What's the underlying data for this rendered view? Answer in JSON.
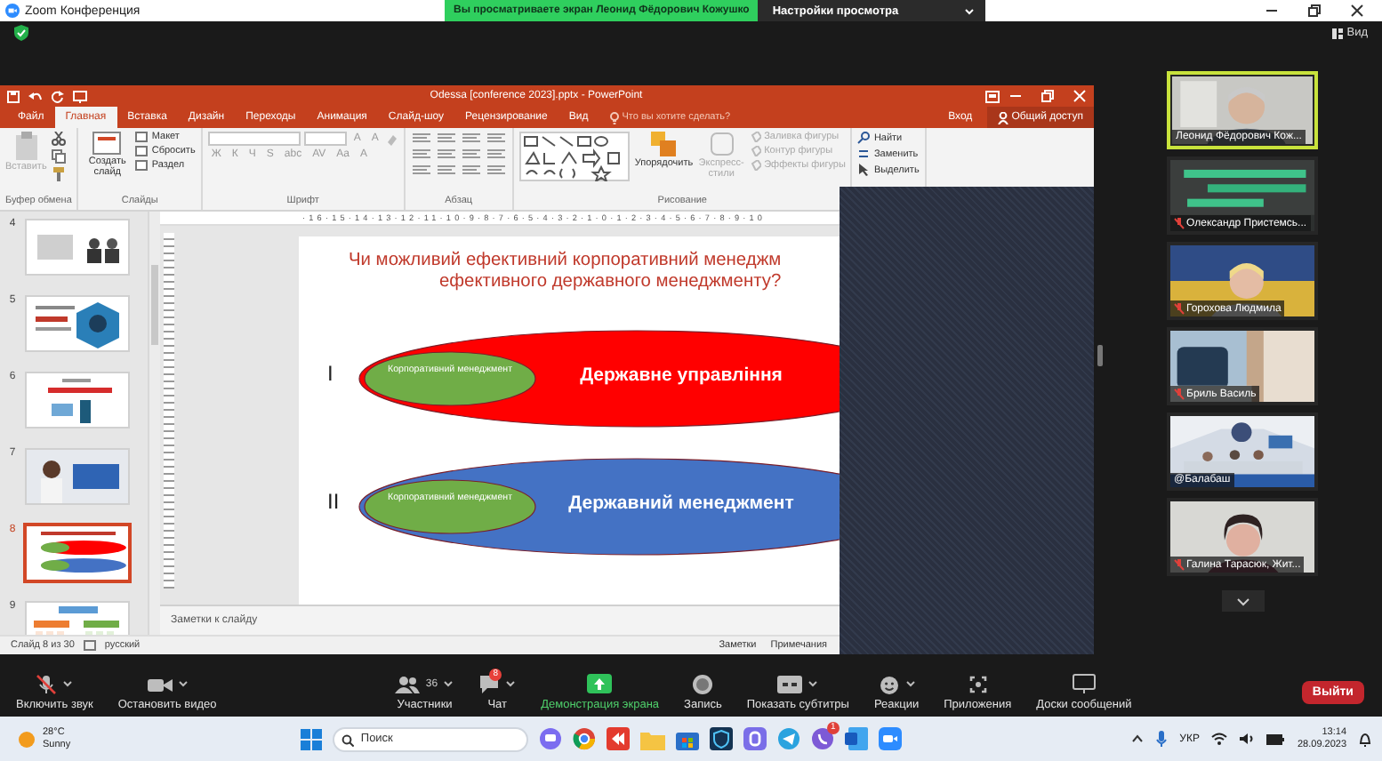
{
  "zoom": {
    "title": "Zoom Конференция",
    "banner": "Вы просматриваете экран Леонид Фёдорович Кожушко",
    "view_settings": "Настройки просмотра",
    "view": "Вид"
  },
  "powerpoint": {
    "title": "Odessa [conference 2023].pptx - PowerPoint",
    "tabs": [
      {
        "label": "Файл",
        "selected": false
      },
      {
        "label": "Главная",
        "selected": true
      },
      {
        "label": "Вставка",
        "selected": false
      },
      {
        "label": "Дизайн",
        "selected": false
      },
      {
        "label": "Переходы",
        "selected": false
      },
      {
        "label": "Анимация",
        "selected": false
      },
      {
        "label": "Слайд-шоу",
        "selected": false
      },
      {
        "label": "Рецензирование",
        "selected": false
      },
      {
        "label": "Вид",
        "selected": false
      }
    ],
    "tell_me": "Что вы хотите сделать?",
    "sign_in": "Вход",
    "share": "Общий доступ",
    "ribbon": [
      {
        "kind": "clipboard",
        "label": "Буфер обмена",
        "items": [
          {
            "label": "Вставить",
            "disabled": true
          }
        ]
      },
      {
        "kind": "slides",
        "label": "Слайды",
        "items": [
          {
            "label": "Создать слайд",
            "disabled": false
          },
          {
            "label": "Макет",
            "disabled": false
          },
          {
            "label": "Сбросить",
            "disabled": false
          },
          {
            "label": "Раздел",
            "disabled": false
          }
        ]
      },
      {
        "kind": "font",
        "label": "Шрифт",
        "items": [
          {
            "label": "A",
            "disabled": true
          },
          {
            "label": "A",
            "disabled": true
          },
          {
            "label": "Ж",
            "disabled": true
          },
          {
            "label": "К",
            "disabled": true
          },
          {
            "label": "Ч",
            "disabled": true
          },
          {
            "label": "S",
            "disabled": true
          },
          {
            "label": "abc",
            "disabled": true
          },
          {
            "label": "AV",
            "disabled": true
          },
          {
            "label": "Aa",
            "disabled": true
          },
          {
            "label": "A",
            "disabled": true
          }
        ]
      },
      {
        "kind": "paragraph",
        "label": "Абзац"
      },
      {
        "kind": "drawing",
        "label": "Рисование",
        "items": [
          {
            "label": "Упорядочить",
            "disabled": false
          },
          {
            "label": "Экспресс-стили",
            "disabled": true
          },
          {
            "label": "Заливка фигуры",
            "disabled": true
          },
          {
            "label": "Контур фигуры",
            "disabled": true
          },
          {
            "label": "Эффекты фигуры",
            "disabled": true
          }
        ]
      },
      {
        "kind": "editing",
        "items": [
          {
            "label": "Найти",
            "disabled": false
          },
          {
            "label": "Заменить",
            "disabled": false
          },
          {
            "label": "Выделить",
            "disabled": false
          }
        ]
      }
    ],
    "ruler": "·16·15·14·13·12·11·10·9·8·7·6·5·4·3·2·1·0·1·2·3·4·5·6·7·8·9·10",
    "slides": [
      {
        "number": "4",
        "selected": false
      },
      {
        "number": "5",
        "selected": false
      },
      {
        "number": "6",
        "selected": false
      },
      {
        "number": "7",
        "selected": false
      },
      {
        "number": "8",
        "selected": true
      },
      {
        "number": "9",
        "selected": false
      }
    ],
    "slide": {
      "title": [
        "Чи можливий ефективний корпоративний менеджм",
        "ефективного державного менеджменту?"
      ],
      "rows": [
        {
          "numeral": "I",
          "inner": "Корпоративний менеджмент",
          "outer": "Державне управління",
          "color": "#ff0000"
        },
        {
          "numeral": "II",
          "inner": "Корпоративний менеджмент",
          "outer": "Державний менеджмент",
          "color": "#4472c4"
        }
      ]
    },
    "notes": "Заметки к слайду",
    "status_bar": {
      "slide": "Слайд 8 из 30",
      "language": "русский",
      "notes": "Заметки",
      "comments": "Примечания"
    }
  },
  "participants": [
    {
      "name": "Леонид Фёдорович Кож...",
      "muted": false,
      "speaking": true
    },
    {
      "name": "Олександр Пристемсь...",
      "muted": true,
      "speaking": false
    },
    {
      "name": "Горохова Людмила",
      "muted": true,
      "speaking": false
    },
    {
      "name": "Бриль Василь",
      "muted": true,
      "speaking": false
    },
    {
      "name": "@Балабаш",
      "muted": false,
      "speaking": false
    },
    {
      "name": "Галина Тарасюк, Жит...",
      "muted": true,
      "speaking": false
    }
  ],
  "toolbar": {
    "items": [
      {
        "kind": "mic_muted",
        "label": "Включить звук",
        "menu": true
      },
      {
        "kind": "video",
        "label": "Остановить видео",
        "menu": true
      },
      {
        "kind": "participants",
        "label": "Участники",
        "count": "36",
        "menu": true
      },
      {
        "kind": "chat",
        "label": "Чат",
        "badge": "8",
        "menu": true
      },
      {
        "kind": "share",
        "label": "Демонстрация экрана",
        "menu": false
      },
      {
        "kind": "record",
        "label": "Запись",
        "menu": false
      },
      {
        "kind": "captions",
        "label": "Показать субтитры",
        "menu": true
      },
      {
        "kind": "reactions",
        "label": "Реакции",
        "menu": true
      },
      {
        "kind": "apps",
        "label": "Приложения",
        "menu": false
      },
      {
        "kind": "whiteboards",
        "label": "Доски сообщений",
        "menu": false
      }
    ],
    "leave": "Выйти"
  },
  "taskbar": {
    "temperature": "28°C",
    "condition": "Sunny",
    "search": {
      "placeholder": "Поиск"
    },
    "viber_badge": "1",
    "language": "УКР",
    "time": "13:14",
    "date": "28.09.2023"
  }
}
